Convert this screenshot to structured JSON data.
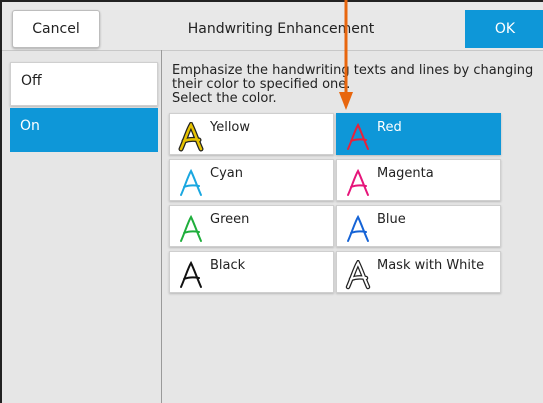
{
  "header": {
    "cancel_label": "Cancel",
    "title": "Handwriting Enhancement",
    "ok_label": "OK"
  },
  "sidebar": {
    "items": [
      {
        "label": "Off",
        "selected": false
      },
      {
        "label": "On",
        "selected": true
      }
    ]
  },
  "main": {
    "description_line1": "Emphasize the handwriting texts and lines by changing",
    "description_line2": "their color to specified one.",
    "description_line3": "Select the color.",
    "colors": [
      {
        "label": "Yellow",
        "icon": "letter-a-yellow-icon",
        "color": "#e6c200",
        "selected": false
      },
      {
        "label": "Red",
        "icon": "letter-a-red-icon",
        "color": "#e8213a",
        "selected": true
      },
      {
        "label": "Cyan",
        "icon": "letter-a-cyan-icon",
        "color": "#1aa7e0",
        "selected": false
      },
      {
        "label": "Magenta",
        "icon": "letter-a-magenta-icon",
        "color": "#e6157a",
        "selected": false
      },
      {
        "label": "Green",
        "icon": "letter-a-green-icon",
        "color": "#1fae3c",
        "selected": false
      },
      {
        "label": "Blue",
        "icon": "letter-a-blue-icon",
        "color": "#1563d6",
        "selected": false
      },
      {
        "label": "Black",
        "icon": "letter-a-black-icon",
        "color": "#111111",
        "selected": false
      },
      {
        "label": "Mask with White",
        "icon": "letter-a-outline-icon",
        "color": "#111111",
        "selected": false
      }
    ]
  },
  "theme": {
    "accent": "#0e97d8",
    "annotation_arrow": "#e8660e"
  }
}
